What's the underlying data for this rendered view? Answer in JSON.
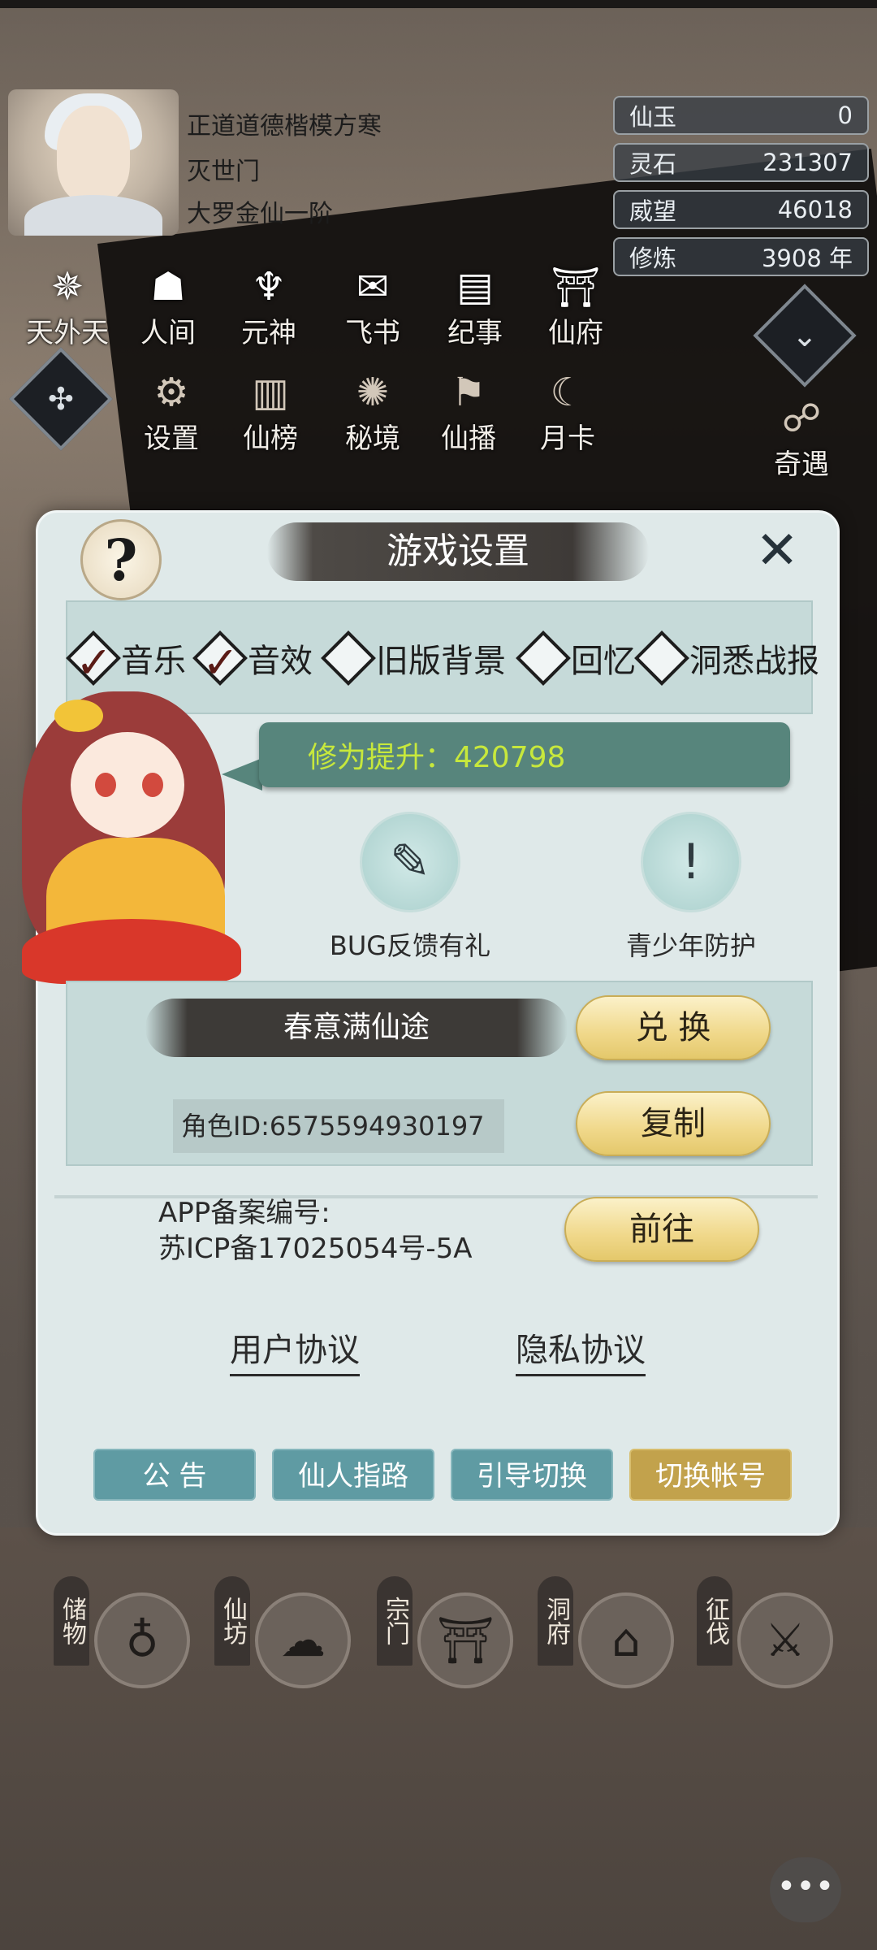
{
  "player": {
    "title": "正道道德楷模方寒",
    "sect": "灭世门",
    "realm": "大罗金仙一阶"
  },
  "resources": [
    {
      "label": "仙玉",
      "value": "0"
    },
    {
      "label": "灵石",
      "value": "231307"
    },
    {
      "label": "威望",
      "value": "46018"
    },
    {
      "label": "修炼",
      "value": "3908 年"
    }
  ],
  "menu_row1": [
    "天外天",
    "人间",
    "元神",
    "飞书",
    "纪事",
    "仙府"
  ],
  "menu_row2": [
    "设置",
    "仙榜",
    "秘境",
    "仙播",
    "月卡"
  ],
  "side_label": "奇遇",
  "dialog": {
    "title": "游戏设置",
    "help": "?",
    "close": "✕",
    "options": [
      {
        "label": "音乐",
        "checked": true
      },
      {
        "label": "音效",
        "checked": true
      },
      {
        "label": "旧版背景",
        "checked": false
      },
      {
        "label": "回忆",
        "checked": false
      },
      {
        "label": "洞悉战报",
        "checked": false
      }
    ],
    "bubble": "修为提升：420798",
    "bug_feedback": "BUG反馈有礼",
    "youth_protect": "青少年防护",
    "redeem_text": "春意满仙途",
    "redeem_button": "兑 换",
    "role_id": "角色ID:6575594930197",
    "copy_button": "复制",
    "icp_line1": "APP备案编号:",
    "icp_line2": "苏ICP备17025054号-5A",
    "goto_button": "前往",
    "user_agreement": "用户协议",
    "privacy_agreement": "隐私协议",
    "footer_buttons": [
      "公 告",
      "仙人指路",
      "引导切换",
      "切换帐号"
    ]
  },
  "bottom_nav": [
    {
      "label": "储物"
    },
    {
      "label": "仙坊"
    },
    {
      "label": "宗门"
    },
    {
      "label": "洞府"
    },
    {
      "label": "征伐"
    }
  ],
  "chat": "•••"
}
